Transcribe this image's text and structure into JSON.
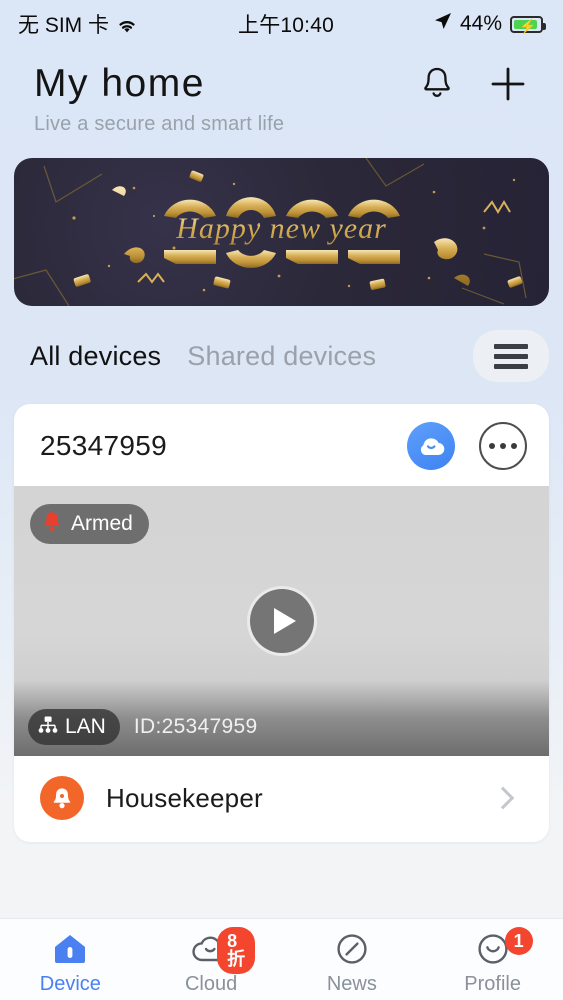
{
  "statusbar": {
    "carrier": "无 SIM 卡",
    "wifi_icon": "wifi-icon",
    "time": "上午10:40",
    "location_icon": "location-arrow-icon",
    "battery_percent": "44%",
    "battery_icon": "battery-charging-icon"
  },
  "header": {
    "title": "My home",
    "subtitle": "Live a secure and smart life",
    "bell_icon": "bell-icon",
    "add_icon": "plus-icon"
  },
  "banner": {
    "year": "2022",
    "greeting": "Happy new year"
  },
  "tabs": {
    "items": [
      {
        "label": "All devices",
        "active": true
      },
      {
        "label": "Shared devices",
        "active": false
      }
    ],
    "menu_icon": "hamburger-menu-icon"
  },
  "device_card": {
    "name": "25347959",
    "cloud_icon": "cloud-icon",
    "more_icon": "more-dots-icon",
    "armed_badge": {
      "label": "Armed",
      "icon": "alarm-bell-icon"
    },
    "play_icon": "play-icon",
    "lan_badge": {
      "label": "LAN",
      "icon": "network-lan-icon"
    },
    "device_id": "ID:25347959",
    "row": {
      "label": "Housekeeper",
      "icon": "housekeeper-bell-icon",
      "chevron_icon": "chevron-right-icon"
    }
  },
  "bottom_nav": {
    "items": [
      {
        "label": "Device",
        "icon": "home-icon",
        "active": true,
        "badge": ""
      },
      {
        "label": "Cloud",
        "icon": "cloud-icon",
        "active": false,
        "badge": "8折"
      },
      {
        "label": "News",
        "icon": "compass-icon",
        "active": false,
        "badge": ""
      },
      {
        "label": "Profile",
        "icon": "face-icon",
        "active": false,
        "badge": "1"
      }
    ]
  },
  "colors": {
    "accent_blue": "#4a80f0",
    "badge_red": "#f4462f",
    "orange": "#f2662a",
    "background": "#dce6f5"
  }
}
